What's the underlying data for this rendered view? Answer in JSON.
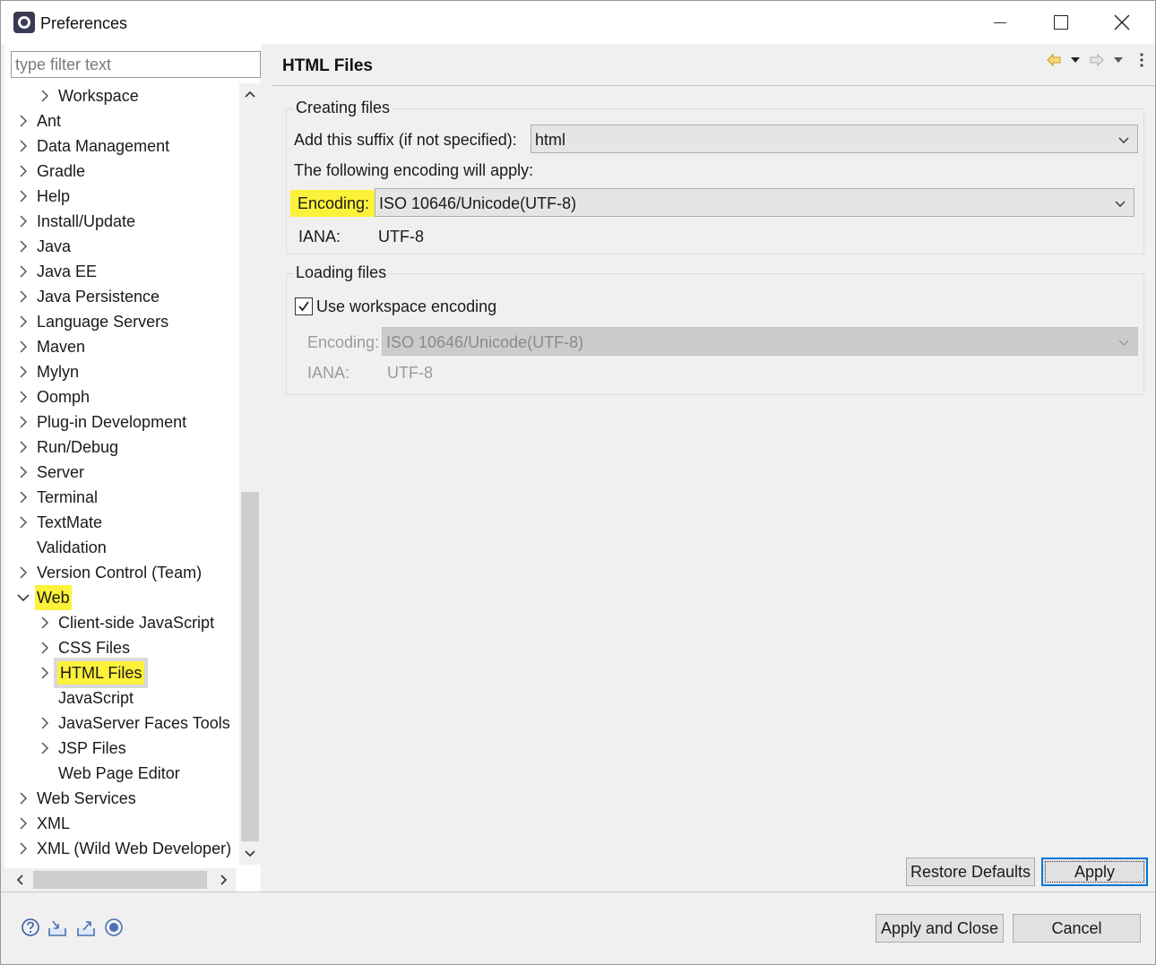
{
  "window": {
    "title": "Preferences",
    "minimize_icon": "minimize-icon",
    "maximize_icon": "maximize-icon",
    "close_icon": "close-icon"
  },
  "filter": {
    "placeholder": "type filter text",
    "value": ""
  },
  "tree": {
    "items": [
      {
        "label": "Workspace",
        "level": 1,
        "expander": "collapsed"
      },
      {
        "label": "Ant",
        "level": 0,
        "expander": "collapsed"
      },
      {
        "label": "Data Management",
        "level": 0,
        "expander": "collapsed"
      },
      {
        "label": "Gradle",
        "level": 0,
        "expander": "collapsed"
      },
      {
        "label": "Help",
        "level": 0,
        "expander": "collapsed"
      },
      {
        "label": "Install/Update",
        "level": 0,
        "expander": "collapsed"
      },
      {
        "label": "Java",
        "level": 0,
        "expander": "collapsed"
      },
      {
        "label": "Java EE",
        "level": 0,
        "expander": "collapsed"
      },
      {
        "label": "Java Persistence",
        "level": 0,
        "expander": "collapsed"
      },
      {
        "label": "Language Servers",
        "level": 0,
        "expander": "collapsed"
      },
      {
        "label": "Maven",
        "level": 0,
        "expander": "collapsed"
      },
      {
        "label": "Mylyn",
        "level": 0,
        "expander": "collapsed"
      },
      {
        "label": "Oomph",
        "level": 0,
        "expander": "collapsed"
      },
      {
        "label": "Plug-in Development",
        "level": 0,
        "expander": "collapsed"
      },
      {
        "label": "Run/Debug",
        "level": 0,
        "expander": "collapsed"
      },
      {
        "label": "Server",
        "level": 0,
        "expander": "collapsed"
      },
      {
        "label": "Terminal",
        "level": 0,
        "expander": "collapsed"
      },
      {
        "label": "TextMate",
        "level": 0,
        "expander": "collapsed"
      },
      {
        "label": "Validation",
        "level": 0,
        "expander": "none"
      },
      {
        "label": "Version Control (Team)",
        "level": 0,
        "expander": "collapsed"
      },
      {
        "label": "Web",
        "level": 0,
        "expander": "expanded",
        "highlight": true
      },
      {
        "label": "Client-side JavaScript",
        "level": 1,
        "expander": "collapsed"
      },
      {
        "label": "CSS Files",
        "level": 1,
        "expander": "collapsed"
      },
      {
        "label": "HTML Files",
        "level": 1,
        "expander": "collapsed",
        "highlight": true,
        "selected": true
      },
      {
        "label": "JavaScript",
        "level": 1,
        "expander": "none"
      },
      {
        "label": "JavaServer Faces Tools",
        "level": 1,
        "expander": "collapsed"
      },
      {
        "label": "JSP Files",
        "level": 1,
        "expander": "collapsed"
      },
      {
        "label": "Web Page Editor",
        "level": 1,
        "expander": "none"
      },
      {
        "label": "Web Services",
        "level": 0,
        "expander": "collapsed"
      },
      {
        "label": "XML",
        "level": 0,
        "expander": "collapsed"
      },
      {
        "label": "XML (Wild Web Developer)",
        "level": 0,
        "expander": "collapsed"
      }
    ]
  },
  "page": {
    "title": "HTML Files",
    "nav_icons": [
      "back-arrow-icon",
      "back-dropdown-icon",
      "forward-arrow-icon",
      "forward-dropdown-icon",
      "view-menu-icon"
    ],
    "creating": {
      "group_title": "Creating files",
      "suffix_label": "Add this suffix (if not specified):",
      "suffix_value": "html",
      "encoding_intro": "The following encoding will apply:",
      "encoding_label": "Encoding:",
      "encoding_value": "ISO 10646/Unicode(UTF-8)",
      "iana_label": "IANA:",
      "iana_value": "UTF-8"
    },
    "loading": {
      "group_title": "Loading files",
      "use_workspace_label": "Use workspace encoding",
      "use_workspace_checked": true,
      "encoding_label": "Encoding:",
      "encoding_value": "ISO 10646/Unicode(UTF-8)",
      "iana_label": "IANA:",
      "iana_value": "UTF-8"
    },
    "restore_defaults_label": "Restore Defaults",
    "apply_label": "Apply"
  },
  "footer": {
    "icons": [
      "help-icon",
      "import-icon",
      "export-icon",
      "record-icon"
    ],
    "apply_close_label": "Apply and Close",
    "cancel_label": "Cancel"
  },
  "colors": {
    "highlight": "#fdf23a",
    "default_button_border": "#0078d7",
    "disabled_text": "#9a9a9a"
  }
}
